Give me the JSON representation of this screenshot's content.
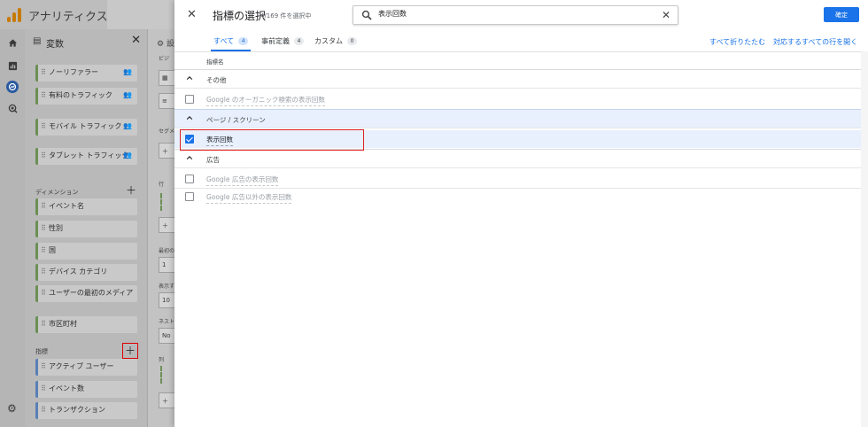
{
  "app": {
    "title": "アナリティクス",
    "brand_color": "#f9ab00"
  },
  "left_panel": {
    "title": "変数",
    "icon": "variables-icon",
    "metric_chips_top": [
      {
        "label": "ノーリファラー",
        "icon": "people-icon"
      },
      {
        "label": "有料のトラフィック",
        "icon": "people-icon"
      },
      {
        "label": "モバイル トラフィック",
        "icon": "people-icon"
      },
      {
        "label": "タブレット トラフィック",
        "icon": "people-icon"
      }
    ],
    "dimensions_label": "ディメンション",
    "dimensions": [
      "イベント名",
      "性別",
      "国",
      "デバイス カテゴリ",
      "ユーザーの最初のメディア",
      "市区町村"
    ],
    "metrics_label": "指標",
    "metrics": [
      "アクティブ ユーザー",
      "イベント数",
      "トランザクション"
    ]
  },
  "settings_panel": {
    "title": "設",
    "labels": [
      "ビジ",
      "セグメ",
      "行",
      "最初の",
      "表示す",
      "ネスト",
      "列"
    ],
    "values": [
      "1",
      "10",
      "No"
    ]
  },
  "dialog": {
    "title": "指標の選択",
    "count": "4/169 件を選択中",
    "search_value": "表示回数",
    "search_placeholder": "検索",
    "confirm_label": "確定",
    "tabs": [
      {
        "label": "すべて",
        "count": "4",
        "active": true
      },
      {
        "label": "事前定義",
        "count": "4",
        "active": false
      },
      {
        "label": "カスタム",
        "count": "0",
        "active": false
      }
    ],
    "collapse_all_label": "すべて折りたたむ",
    "expand_matching_label": "対応するすべての行を開く",
    "column_header": "指標名",
    "groups": [
      {
        "label": "その他",
        "items": [
          {
            "label": "Google のオーガニック検索の表示回数",
            "checked": false
          }
        ]
      },
      {
        "label": "ページ / スクリーン",
        "items": [
          {
            "label": "表示回数",
            "checked": true
          }
        ]
      },
      {
        "label": "広告",
        "items": [
          {
            "label": "Google 広告の表示回数",
            "checked": false
          },
          {
            "label": "Google 広告以外の表示回数",
            "checked": false
          }
        ]
      }
    ]
  },
  "colors": {
    "accent": "#1a73e8",
    "highlight": "#e8f0fe",
    "annotation_red": "#e02020",
    "dimension_bar": "#6b8f55",
    "metric_bar": "#5a7fb5"
  }
}
